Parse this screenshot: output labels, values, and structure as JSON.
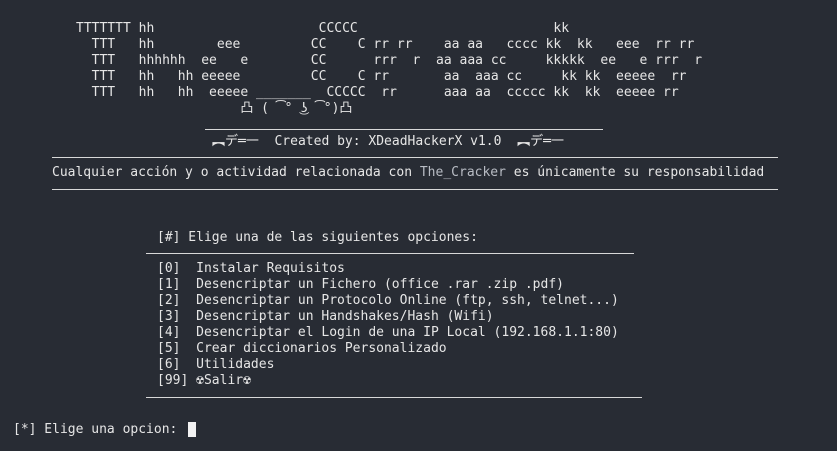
{
  "terminal": {
    "banner": [
      "TTTTTTT hh                     CCCCC                         kk",
      "  TTT   hh        eee         CC    C rr rr    aa aa   cccc kk  kk   eee  rr rr",
      "  TTT   hhhhhh  ee   e        CC      rrr  r  aa aaa cc     kkkkk  ee   e rrr  r",
      "  TTT   hh   hh eeeee         CC    C rr       aa  aaa cc     kk kk  eeeee  rr",
      "  TTT   hh   hh  eeeee _______  CCCCC  rr      aaa aa  ccccc kk  kk  eeeee rr",
      "                     凸 ( ͡° ͜ʖ ͡°)凸"
    ],
    "credit": {
      "left_gun": "︻デ═一",
      "text": "Created by: XDeadHackerX v1.0",
      "right_gun": "︻デ═一"
    },
    "disclaimer": {
      "before": "Cualquier acción y o actividad relacionada con ",
      "brand": "The_Cracker",
      "after": " es únicamente su responsabilidad"
    },
    "menu": {
      "title": "[#] Elige una de las siguientes opciones:",
      "options": [
        {
          "key": "[0]",
          "label": "Instalar Requisitos"
        },
        {
          "key": "[1]",
          "label": "Desencriptar un Fichero (office .rar .zip .pdf)"
        },
        {
          "key": "[2]",
          "label": "Desencriptar un Protocolo Online (ftp, ssh, telnet...)"
        },
        {
          "key": "[3]",
          "label": "Desencriptar un Handshakes/Hash (Wifi)"
        },
        {
          "key": "[4]",
          "label": "Desencriptar el Login de una IP Local (192.168.1.1:80)"
        },
        {
          "key": "[5]",
          "label": "Crear diccionarios Personalizado"
        },
        {
          "key": "[6]",
          "label": "Utilidades"
        },
        {
          "key": "[99]",
          "label": "☢Salir☢"
        }
      ]
    },
    "prompt": "[*] Elige una opcion: "
  }
}
